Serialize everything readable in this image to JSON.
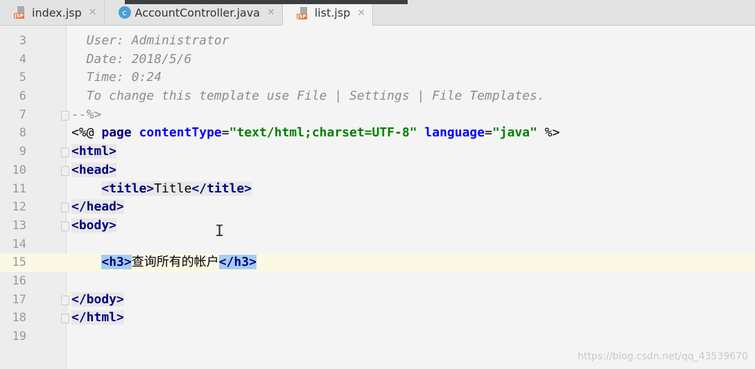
{
  "tabs": [
    {
      "label": "index.jsp",
      "icon": "jsp-file-icon",
      "active": false
    },
    {
      "label": "AccountController.java",
      "icon": "java-class-icon",
      "active": false
    },
    {
      "label": "list.jsp",
      "icon": "jsp-file-icon",
      "active": true
    }
  ],
  "lines": [
    {
      "n": "3",
      "tokens": [
        {
          "t": "  User: Administrator",
          "c": "cm"
        }
      ]
    },
    {
      "n": "4",
      "tokens": [
        {
          "t": "  Date: 2018/5/6",
          "c": "cm"
        }
      ]
    },
    {
      "n": "5",
      "tokens": [
        {
          "t": "  Time: 0:24",
          "c": "cm"
        }
      ]
    },
    {
      "n": "6",
      "tokens": [
        {
          "t": "  To change this template use File | Settings | File Templates.",
          "c": "cm"
        }
      ]
    },
    {
      "n": "7",
      "fold": true,
      "tokens": [
        {
          "t": "--%>",
          "c": "cm"
        }
      ]
    },
    {
      "n": "8",
      "tokens": [
        {
          "t": "<%@ ",
          "c": "pl"
        },
        {
          "t": "page ",
          "c": "tag"
        },
        {
          "t": "contentType",
          "c": "attr"
        },
        {
          "t": "=",
          "c": "pl"
        },
        {
          "t": "\"text/html;charset=UTF-8\"",
          "c": "str"
        },
        {
          "t": " ",
          "c": "pl"
        },
        {
          "t": "language",
          "c": "attr"
        },
        {
          "t": "=",
          "c": "pl"
        },
        {
          "t": "\"java\"",
          "c": "str"
        },
        {
          "t": " %>",
          "c": "pl"
        }
      ]
    },
    {
      "n": "9",
      "fold": true,
      "tokens": [
        {
          "t": "<html>",
          "c": "tag tagbg"
        }
      ]
    },
    {
      "n": "10",
      "fold": true,
      "tokens": [
        {
          "t": "<head>",
          "c": "tag tagbg"
        }
      ]
    },
    {
      "n": "11",
      "tokens": [
        {
          "t": "    ",
          "c": "pl"
        },
        {
          "t": "<title>",
          "c": "tag tagbg"
        },
        {
          "t": "Title",
          "c": "pl tagbg"
        },
        {
          "t": "</title>",
          "c": "tag tagbg"
        }
      ]
    },
    {
      "n": "12",
      "fold": true,
      "tokens": [
        {
          "t": "</head>",
          "c": "tag tagbg"
        }
      ]
    },
    {
      "n": "13",
      "fold": true,
      "tokens": [
        {
          "t": "<body>",
          "c": "tag tagbg"
        }
      ]
    },
    {
      "n": "14",
      "tokens": []
    },
    {
      "n": "15",
      "current": true,
      "tokens": [
        {
          "t": "    ",
          "c": "pl"
        },
        {
          "t": "<h3>",
          "c": "tag sel"
        },
        {
          "t": "查询所有的帐户",
          "c": "pl"
        },
        {
          "t": "</h3>",
          "c": "tag sel"
        }
      ]
    },
    {
      "n": "16",
      "tokens": []
    },
    {
      "n": "17",
      "fold": true,
      "tokens": [
        {
          "t": "</body>",
          "c": "tag tagbg"
        }
      ]
    },
    {
      "n": "18",
      "fold": true,
      "tokens": [
        {
          "t": "</html>",
          "c": "tag tagbg"
        }
      ]
    },
    {
      "n": "19",
      "tokens": []
    }
  ],
  "watermark": "https://blog.csdn.net/qq_43539670"
}
